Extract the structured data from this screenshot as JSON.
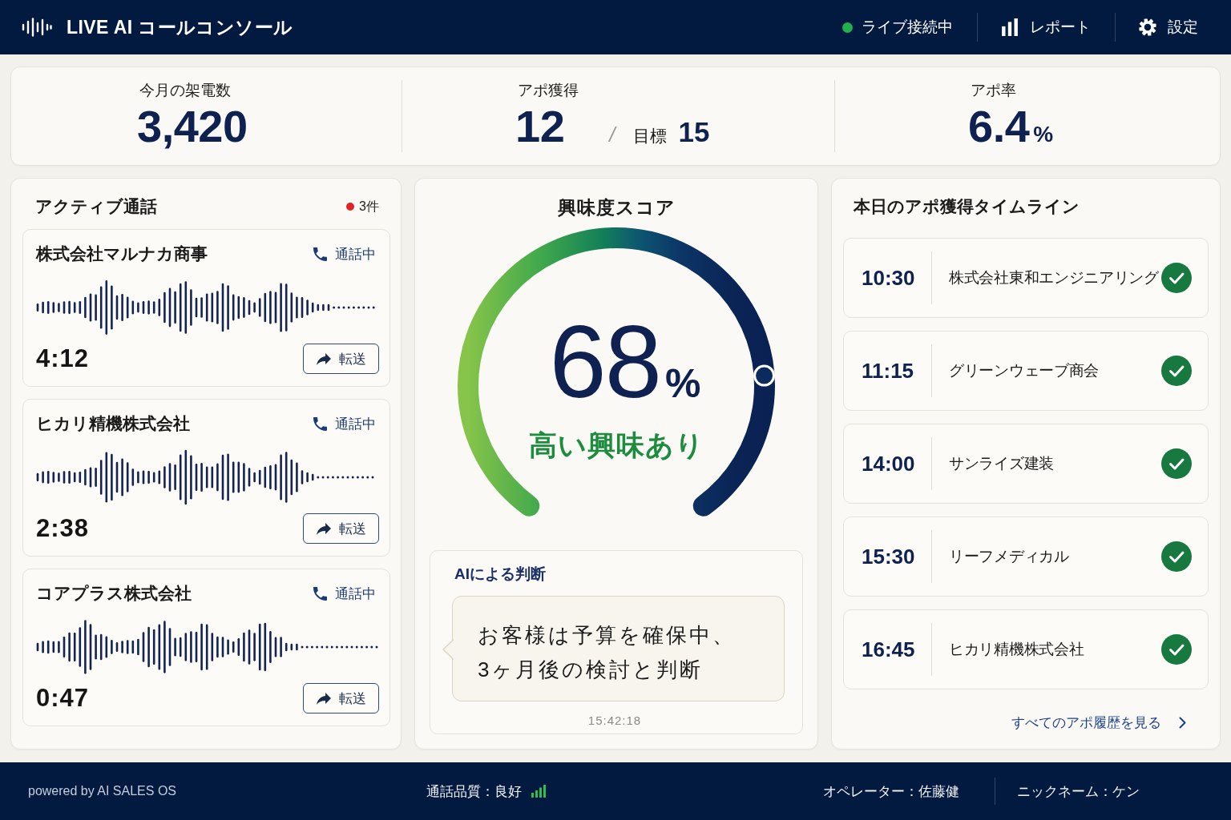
{
  "header": {
    "title": "LIVE AI コールコンソール",
    "status": {
      "label": "ライブ接続中",
      "connected": true
    },
    "nav": [
      {
        "kind": "chart",
        "label": "レポート"
      },
      {
        "kind": "gear",
        "label": "設定"
      }
    ]
  },
  "stats": [
    {
      "label": "今月の架電数",
      "value": "3,420"
    },
    {
      "label": "アポ獲得",
      "value": "12",
      "separator": "/",
      "target_label": "目標",
      "target_value": "15"
    },
    {
      "label": "アポ率",
      "value": "6.4",
      "unit": "%"
    }
  ],
  "active_calls": {
    "title": "アクティブ通話",
    "count": "3件",
    "calls": [
      {
        "company": "株式会社マルナカ商事",
        "status": "通話中",
        "duration": "4:12",
        "action": "転送"
      },
      {
        "company": "ヒカリ精機株式会社",
        "status": "通話中",
        "duration": "2:38",
        "action": "転送"
      },
      {
        "company": "コアプラス株式会社",
        "status": "通話中",
        "duration": "0:47",
        "action": "転送"
      }
    ]
  },
  "interest_score": {
    "title": "興味度スコア",
    "value": "68",
    "unit": "%",
    "verdict": "高い興味あり",
    "ai_judgment": {
      "label": "AIによる判断",
      "text": "お客様は予算を確保中、\n3ヶ月後の検討と判断",
      "timestamp": "15:42:18"
    }
  },
  "timeline": {
    "title": "本日のアポ獲得タイムライン",
    "items": [
      {
        "time": "10:30",
        "company": "株式会社東和エンジニアリング",
        "done": true
      },
      {
        "time": "11:15",
        "company": "グリーンウェーブ商会",
        "done": true
      },
      {
        "time": "14:00",
        "company": "サンライズ建装",
        "done": true
      },
      {
        "time": "15:30",
        "company": "リーフメディカル",
        "done": true
      },
      {
        "time": "16:45",
        "company": "ヒカリ精機株式会社",
        "done": true
      }
    ],
    "link": "すべてのアポ履歴を見る"
  },
  "footer": {
    "powered_by": "powered by AI SALES OS",
    "quality": "通話品質：良好",
    "operator": "オペレーター：佐藤健",
    "nickname": "ニックネーム：ケン"
  }
}
